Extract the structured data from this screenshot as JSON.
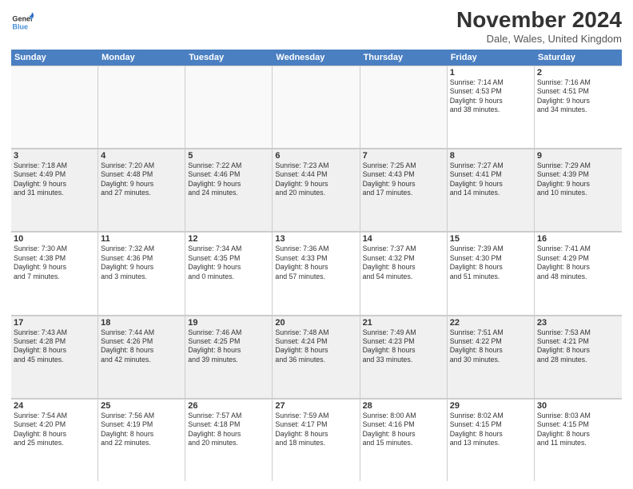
{
  "logo": {
    "line1": "General",
    "line2": "Blue"
  },
  "title": "November 2024",
  "location": "Dale, Wales, United Kingdom",
  "headers": [
    "Sunday",
    "Monday",
    "Tuesday",
    "Wednesday",
    "Thursday",
    "Friday",
    "Saturday"
  ],
  "rows": [
    [
      {
        "day": "",
        "info": ""
      },
      {
        "day": "",
        "info": ""
      },
      {
        "day": "",
        "info": ""
      },
      {
        "day": "",
        "info": ""
      },
      {
        "day": "",
        "info": ""
      },
      {
        "day": "1",
        "info": "Sunrise: 7:14 AM\nSunset: 4:53 PM\nDaylight: 9 hours\nand 38 minutes."
      },
      {
        "day": "2",
        "info": "Sunrise: 7:16 AM\nSunset: 4:51 PM\nDaylight: 9 hours\nand 34 minutes."
      }
    ],
    [
      {
        "day": "3",
        "info": "Sunrise: 7:18 AM\nSunset: 4:49 PM\nDaylight: 9 hours\nand 31 minutes."
      },
      {
        "day": "4",
        "info": "Sunrise: 7:20 AM\nSunset: 4:48 PM\nDaylight: 9 hours\nand 27 minutes."
      },
      {
        "day": "5",
        "info": "Sunrise: 7:22 AM\nSunset: 4:46 PM\nDaylight: 9 hours\nand 24 minutes."
      },
      {
        "day": "6",
        "info": "Sunrise: 7:23 AM\nSunset: 4:44 PM\nDaylight: 9 hours\nand 20 minutes."
      },
      {
        "day": "7",
        "info": "Sunrise: 7:25 AM\nSunset: 4:43 PM\nDaylight: 9 hours\nand 17 minutes."
      },
      {
        "day": "8",
        "info": "Sunrise: 7:27 AM\nSunset: 4:41 PM\nDaylight: 9 hours\nand 14 minutes."
      },
      {
        "day": "9",
        "info": "Sunrise: 7:29 AM\nSunset: 4:39 PM\nDaylight: 9 hours\nand 10 minutes."
      }
    ],
    [
      {
        "day": "10",
        "info": "Sunrise: 7:30 AM\nSunset: 4:38 PM\nDaylight: 9 hours\nand 7 minutes."
      },
      {
        "day": "11",
        "info": "Sunrise: 7:32 AM\nSunset: 4:36 PM\nDaylight: 9 hours\nand 3 minutes."
      },
      {
        "day": "12",
        "info": "Sunrise: 7:34 AM\nSunset: 4:35 PM\nDaylight: 9 hours\nand 0 minutes."
      },
      {
        "day": "13",
        "info": "Sunrise: 7:36 AM\nSunset: 4:33 PM\nDaylight: 8 hours\nand 57 minutes."
      },
      {
        "day": "14",
        "info": "Sunrise: 7:37 AM\nSunset: 4:32 PM\nDaylight: 8 hours\nand 54 minutes."
      },
      {
        "day": "15",
        "info": "Sunrise: 7:39 AM\nSunset: 4:30 PM\nDaylight: 8 hours\nand 51 minutes."
      },
      {
        "day": "16",
        "info": "Sunrise: 7:41 AM\nSunset: 4:29 PM\nDaylight: 8 hours\nand 48 minutes."
      }
    ],
    [
      {
        "day": "17",
        "info": "Sunrise: 7:43 AM\nSunset: 4:28 PM\nDaylight: 8 hours\nand 45 minutes."
      },
      {
        "day": "18",
        "info": "Sunrise: 7:44 AM\nSunset: 4:26 PM\nDaylight: 8 hours\nand 42 minutes."
      },
      {
        "day": "19",
        "info": "Sunrise: 7:46 AM\nSunset: 4:25 PM\nDaylight: 8 hours\nand 39 minutes."
      },
      {
        "day": "20",
        "info": "Sunrise: 7:48 AM\nSunset: 4:24 PM\nDaylight: 8 hours\nand 36 minutes."
      },
      {
        "day": "21",
        "info": "Sunrise: 7:49 AM\nSunset: 4:23 PM\nDaylight: 8 hours\nand 33 minutes."
      },
      {
        "day": "22",
        "info": "Sunrise: 7:51 AM\nSunset: 4:22 PM\nDaylight: 8 hours\nand 30 minutes."
      },
      {
        "day": "23",
        "info": "Sunrise: 7:53 AM\nSunset: 4:21 PM\nDaylight: 8 hours\nand 28 minutes."
      }
    ],
    [
      {
        "day": "24",
        "info": "Sunrise: 7:54 AM\nSunset: 4:20 PM\nDaylight: 8 hours\nand 25 minutes."
      },
      {
        "day": "25",
        "info": "Sunrise: 7:56 AM\nSunset: 4:19 PM\nDaylight: 8 hours\nand 22 minutes."
      },
      {
        "day": "26",
        "info": "Sunrise: 7:57 AM\nSunset: 4:18 PM\nDaylight: 8 hours\nand 20 minutes."
      },
      {
        "day": "27",
        "info": "Sunrise: 7:59 AM\nSunset: 4:17 PM\nDaylight: 8 hours\nand 18 minutes."
      },
      {
        "day": "28",
        "info": "Sunrise: 8:00 AM\nSunset: 4:16 PM\nDaylight: 8 hours\nand 15 minutes."
      },
      {
        "day": "29",
        "info": "Sunrise: 8:02 AM\nSunset: 4:15 PM\nDaylight: 8 hours\nand 13 minutes."
      },
      {
        "day": "30",
        "info": "Sunrise: 8:03 AM\nSunset: 4:15 PM\nDaylight: 8 hours\nand 11 minutes."
      }
    ]
  ],
  "shaded_rows": [
    1,
    3
  ]
}
